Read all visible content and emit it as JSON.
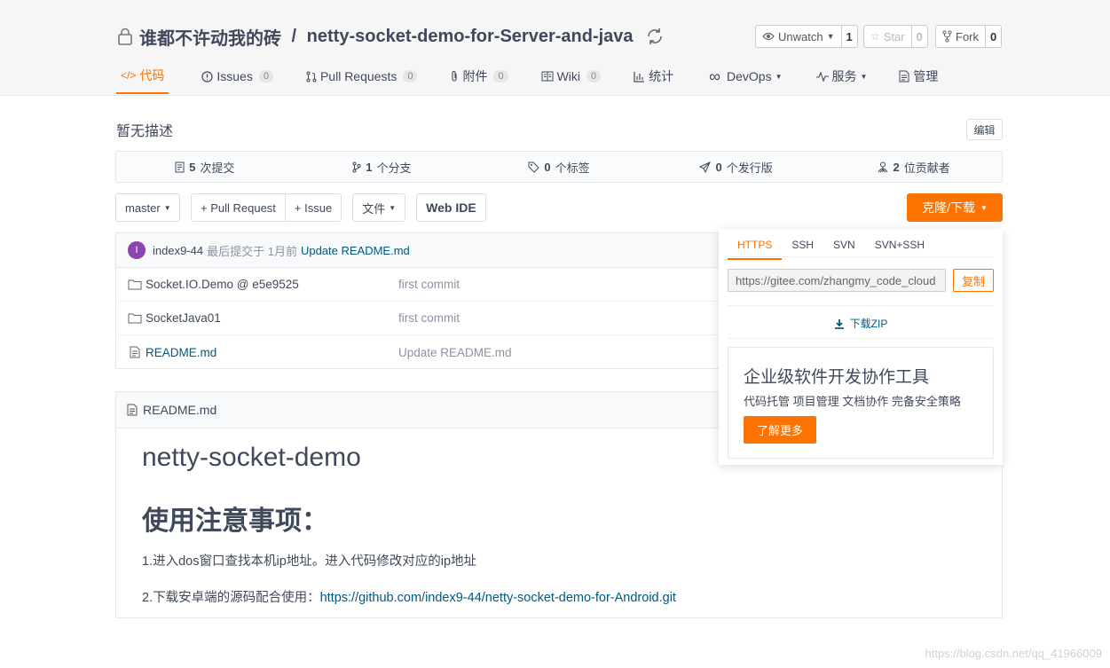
{
  "repo": {
    "owner": "谁都不许动我的砖",
    "separator": " / ",
    "name": "netty-socket-demo-for-Server-and-java"
  },
  "actions": {
    "watch_label": "Unwatch",
    "watch_count": "1",
    "star_label": "Star",
    "star_count": "0",
    "fork_label": "Fork",
    "fork_count": "0"
  },
  "tabs": [
    {
      "label": "代码",
      "active": true
    },
    {
      "label": "Issues",
      "badge": "0"
    },
    {
      "label": "Pull Requests",
      "badge": "0"
    },
    {
      "label": "附件",
      "badge": "0"
    },
    {
      "label": "Wiki",
      "badge": "0"
    },
    {
      "label": "统计"
    },
    {
      "label": "DevOps"
    },
    {
      "label": "服务"
    },
    {
      "label": "管理"
    }
  ],
  "description": "暂无描述",
  "edit_label": "编辑",
  "stats": {
    "commits_num": "5",
    "commits_label": "次提交",
    "branches_num": "1",
    "branches_label": "个分支",
    "tags_num": "0",
    "tags_label": "个标签",
    "releases_num": "0",
    "releases_label": "个发行版",
    "contributors_num": "2",
    "contributors_label": "位贡献者"
  },
  "toolbar": {
    "branch": "master",
    "pull_request": "+ Pull Request",
    "issue": "+ Issue",
    "file": "文件",
    "web_ide": "Web IDE",
    "clone": "克隆/下载"
  },
  "last_commit": {
    "avatar_letter": "I",
    "author": "index9-44",
    "meta": "最后提交于 1月前",
    "message": "Update README.md"
  },
  "files": [
    {
      "name": "Socket.IO.Demo @ e5e9525",
      "commit": "first commit"
    },
    {
      "name": "SocketJava01",
      "commit": "first commit"
    },
    {
      "name": "README.md",
      "commit": "Update README.md"
    }
  ],
  "readme": {
    "header": "README.md",
    "h1": "netty-socket-demo",
    "h2": "使用注意事项：",
    "p1": "1.进入dos窗口查找本机ip地址。进入代码修改对应的ip地址",
    "p2_prefix": "2.下载安卓端的源码配合使用：",
    "p2_link": "https://github.com/index9-44/netty-socket-demo-for-Android.git"
  },
  "clone_panel": {
    "tabs": [
      "HTTPS",
      "SSH",
      "SVN",
      "SVN+SSH"
    ],
    "url": "https://gitee.com/zhangmy_code_cloud",
    "copy": "复制",
    "zip": "下载ZIP",
    "promo_title": "企业级软件开发协作工具",
    "promo_sub": "代码托管 项目管理 文档协作 完备安全策略",
    "promo_btn": "了解更多"
  },
  "watermark": "https://blog.csdn.net/qq_41966009",
  "colors": {
    "accent": "#fe7300",
    "link": "#005980",
    "text": "#40485b"
  }
}
